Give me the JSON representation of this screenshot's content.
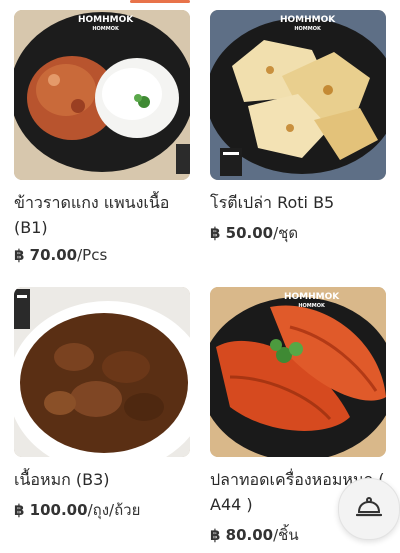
{
  "menu": {
    "items": [
      {
        "name": "ข้าวราดแกง แพนงเนื้อ (B1)",
        "currency": "฿",
        "price": "70.00",
        "unit": "/Pcs"
      },
      {
        "name": "โรตีเปล่า Roti B5",
        "currency": "฿",
        "price": "50.00",
        "unit": "/ชุด"
      },
      {
        "name": "เนื้อหมก (B3)",
        "currency": "฿",
        "price": "100.00",
        "unit": "/ถุง/ถ้วย"
      },
      {
        "name": "ปลาทอดเครื่องหอมหมก ( A44 )",
        "currency": "฿",
        "price": "80.00",
        "unit": "/ชิ้น"
      }
    ]
  },
  "brand": {
    "logo": "HOMHMOK",
    "logo_sub": "HOMMOK"
  },
  "icons": {
    "cart": "cloche-icon"
  },
  "colors": {
    "accent": "#e8734a",
    "plate": "#1b1b1b"
  }
}
